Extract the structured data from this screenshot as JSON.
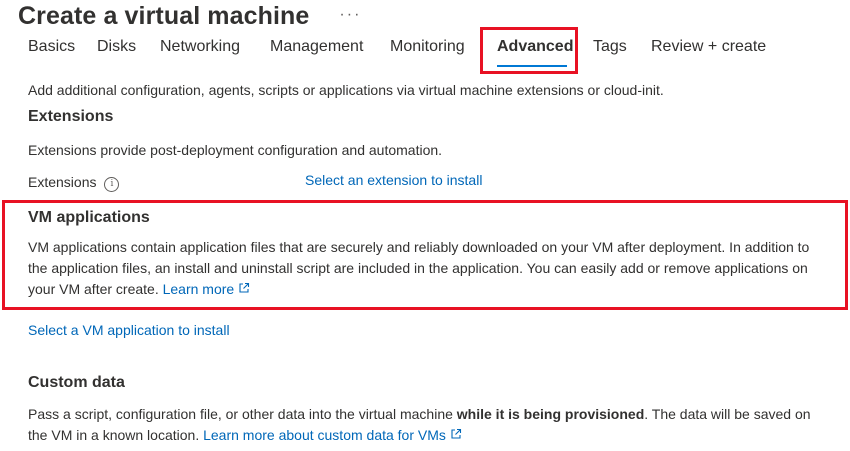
{
  "page": {
    "title": "Create a virtual machine",
    "more_glyph": "···"
  },
  "tabs": [
    {
      "label": "Basics",
      "active": false
    },
    {
      "label": "Disks",
      "active": false
    },
    {
      "label": "Networking",
      "active": false
    },
    {
      "label": "Management",
      "active": false
    },
    {
      "label": "Monitoring",
      "active": false
    },
    {
      "label": "Advanced",
      "active": true
    },
    {
      "label": "Tags",
      "active": false
    },
    {
      "label": "Review + create",
      "active": false
    }
  ],
  "intro": "Add additional configuration, agents, scripts or applications via virtual machine extensions or cloud-init.",
  "extensions": {
    "heading": "Extensions",
    "description": "Extensions provide post-deployment configuration and automation.",
    "field_label": "Extensions",
    "info_glyph": "i",
    "select_link": "Select an extension to install"
  },
  "vm_applications": {
    "heading": "VM applications",
    "description_line1": "VM applications contain application files that are securely and reliably downloaded on your VM after deployment. In addition to",
    "description_line2": "the application files, an install and uninstall script are included in the application. You can easily add or remove applications on",
    "description_line3": "your VM after create.",
    "learn_more": "Learn more",
    "select_link": "Select a VM application to install"
  },
  "custom_data": {
    "heading": "Custom data",
    "description_part1": "Pass a script, configuration file, or other data into the virtual machine ",
    "description_bold": "while it is being provisioned",
    "description_part2": ". The data will be saved on",
    "description_line2": "the VM in a known location.",
    "learn_more": "Learn more about custom data for VMs"
  },
  "colors": {
    "link": "#0067b8",
    "active_tab_underline": "#0078d4",
    "highlight": "#e81123",
    "text": "#323130"
  }
}
